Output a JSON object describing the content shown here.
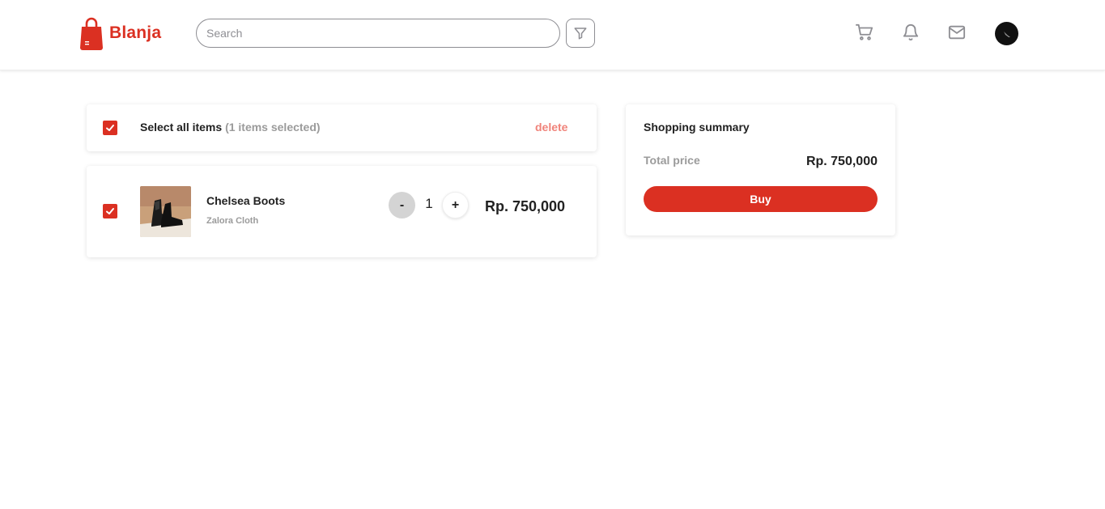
{
  "brand": {
    "name": "Blanja",
    "color": "#db3022"
  },
  "header": {
    "search": {
      "placeholder": "Search",
      "value": ""
    },
    "icons": [
      "filter-icon",
      "cart-icon",
      "bell-icon",
      "mail-icon",
      "avatar"
    ]
  },
  "cart": {
    "select_all": {
      "label": "Select all items",
      "count": "(1 items selected)",
      "checked": true,
      "delete_label": "delete"
    },
    "items": [
      {
        "name": "Chelsea Boots",
        "store": "Zalora Cloth",
        "checked": true,
        "quantity": "1",
        "minus_label": "-",
        "plus_label": "+",
        "price": "Rp. 750,000"
      }
    ]
  },
  "summary": {
    "title": "Shopping summary",
    "total_label": "Total price",
    "total_value": "Rp. 750,000",
    "buy_label": "Buy"
  }
}
